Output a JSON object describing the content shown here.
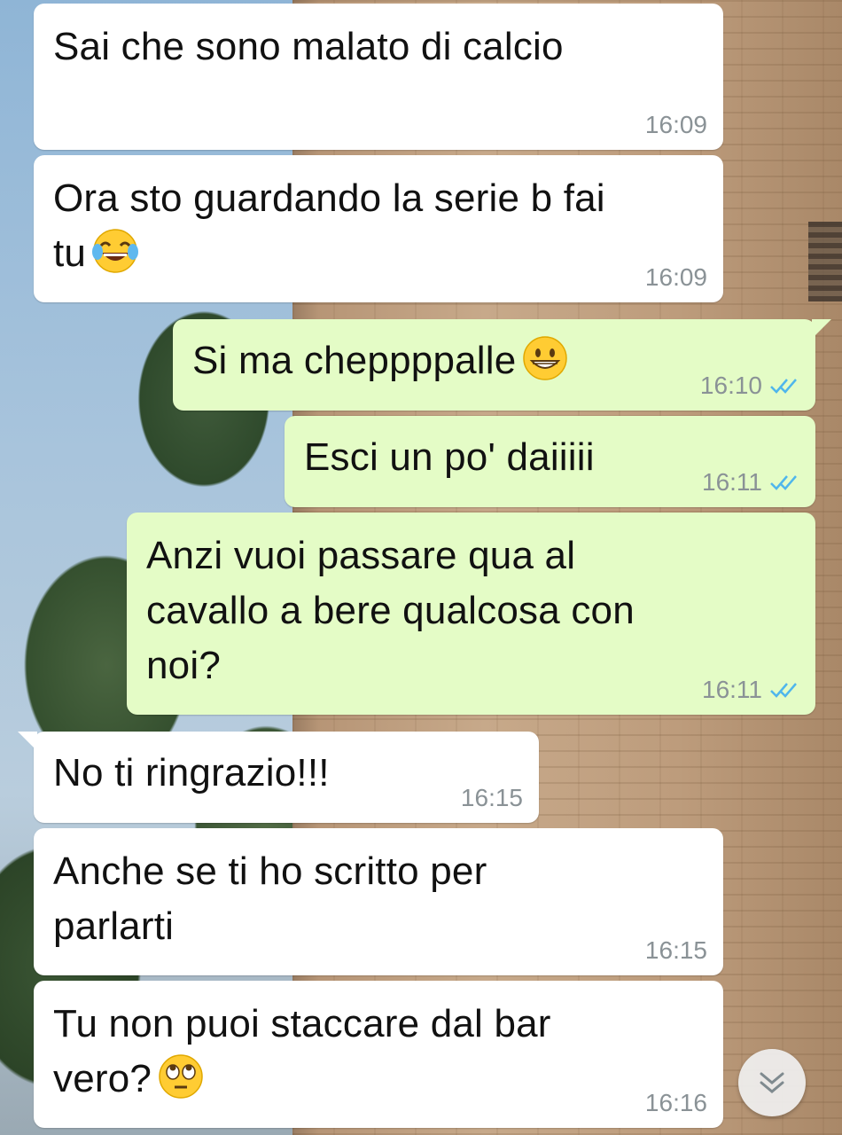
{
  "messages": [
    {
      "id": "m1",
      "direction": "incoming",
      "text": "Sai che sono malato di calcio",
      "time": "16:09"
    },
    {
      "id": "m2",
      "direction": "incoming",
      "text": "Ora sto guardando la serie b fai\ntu",
      "emoji": "face-with-tears-of-joy",
      "time": "16:09"
    },
    {
      "id": "m3",
      "direction": "outgoing",
      "text": "Si ma cheppppalle",
      "emoji": "grinning-face",
      "time": "16:10",
      "status": "read"
    },
    {
      "id": "m4",
      "direction": "outgoing",
      "text": "Esci un po' daiiiii",
      "time": "16:11",
      "status": "read"
    },
    {
      "id": "m5",
      "direction": "outgoing",
      "text": "Anzi vuoi passare qua al\ncavallo a bere qualcosa con\nnoi?",
      "time": "16:11",
      "status": "read"
    },
    {
      "id": "m6",
      "direction": "incoming",
      "text": "No ti ringrazio!!!",
      "time": "16:15"
    },
    {
      "id": "m7",
      "direction": "incoming",
      "text": "Anche se ti ho scritto per\nparlarti",
      "time": "16:15"
    },
    {
      "id": "m8",
      "direction": "incoming",
      "text": "Tu non puoi staccare dal bar\nvero?",
      "emoji": "face-with-rolling-eyes",
      "time": "16:16"
    }
  ],
  "colors": {
    "incoming_bubble": "#ffffff",
    "outgoing_bubble": "#e4fcc6",
    "timestamp": "#8a9296",
    "read_ticks": "#4fb6ec"
  },
  "icons": {
    "scroll_down": "double-chevron-down-icon",
    "read_receipt": "double-check-icon"
  }
}
